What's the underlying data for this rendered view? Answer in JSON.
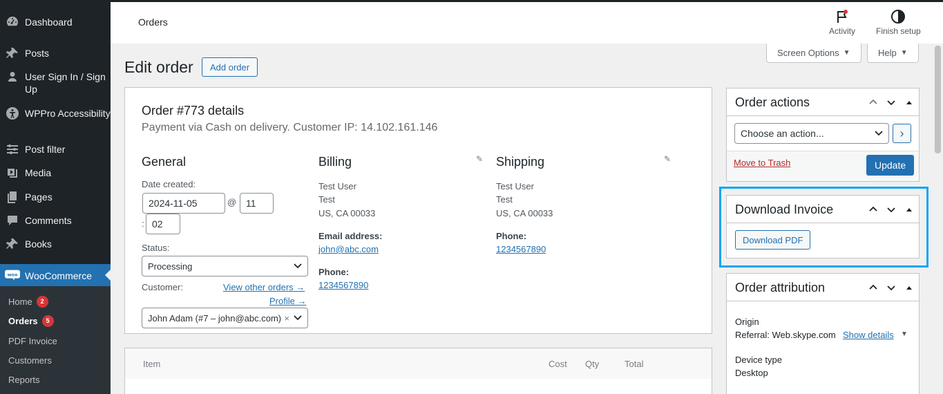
{
  "sidebar": {
    "items": [
      {
        "label": "Dashboard",
        "icon": "dashboard-icon"
      },
      {
        "label": "Posts",
        "icon": "pin-icon"
      },
      {
        "label": "User Sign In / Sign Up",
        "icon": "user-icon"
      },
      {
        "label": "WPPro Accessibility",
        "icon": "accessibility-icon"
      },
      {
        "label": "Post filter",
        "icon": "filter-icon"
      },
      {
        "label": "Media",
        "icon": "media-icon"
      },
      {
        "label": "Pages",
        "icon": "pages-icon"
      },
      {
        "label": "Comments",
        "icon": "comment-icon"
      },
      {
        "label": "Books",
        "icon": "pin-icon"
      },
      {
        "label": "WooCommerce",
        "icon": "woo-icon"
      }
    ],
    "submenu": [
      {
        "label": "Home",
        "badge": "2"
      },
      {
        "label": "Orders",
        "badge": "5"
      },
      {
        "label": "PDF Invoice",
        "badge": ""
      },
      {
        "label": "Customers",
        "badge": ""
      },
      {
        "label": "Reports",
        "badge": ""
      }
    ]
  },
  "header": {
    "crumb": "Orders",
    "activity_label": "Activity",
    "finish_label": "Finish setup"
  },
  "screen_options": "Screen Options",
  "help": "Help",
  "page": {
    "title": "Edit order",
    "add_order": "Add order"
  },
  "order": {
    "title": "Order #773 details",
    "subtitle": "Payment via Cash on delivery. Customer IP: 14.102.161.146",
    "general": {
      "heading": "General",
      "date_label": "Date created:",
      "date": "2024-11-05",
      "at": "@",
      "hour": "11",
      "colon": ":",
      "minute": "02",
      "status_label": "Status:",
      "status": "Processing",
      "customer_label": "Customer:",
      "view_other": "View other orders →",
      "profile": "Profile →",
      "customer": "John Adam (#7 – john@abc.com)",
      "clear": "×"
    },
    "billing": {
      "heading": "Billing",
      "name": "Test User",
      "line2": "Test",
      "line3": "US, CA 00033",
      "email_label": "Email address:",
      "email": "john@abc.com",
      "phone_label": "Phone:",
      "phone": "1234567890"
    },
    "shipping": {
      "heading": "Shipping",
      "name": "Test User",
      "line2": "Test",
      "line3": "US, CA 00033",
      "phone_label": "Phone:",
      "phone": "1234567890"
    }
  },
  "items": {
    "col_item": "Item",
    "col_cost": "Cost",
    "col_qty": "Qty",
    "col_total": "Total"
  },
  "order_actions": {
    "title": "Order actions",
    "select": "Choose an action...",
    "go": "›",
    "trash": "Move to Trash",
    "update": "Update"
  },
  "download_invoice": {
    "title": "Download Invoice",
    "button": "Download PDF"
  },
  "attribution": {
    "title": "Order attribution",
    "origin_label": "Origin",
    "origin_value": "Referral: Web.skype.com",
    "show_details": "Show details",
    "device_label": "Device type",
    "device_value": "Desktop"
  },
  "colors": {
    "sidebar_bg": "#1d2327",
    "accent": "#2271b1",
    "highlight": "#0ea5f0",
    "badge": "#d63638"
  }
}
